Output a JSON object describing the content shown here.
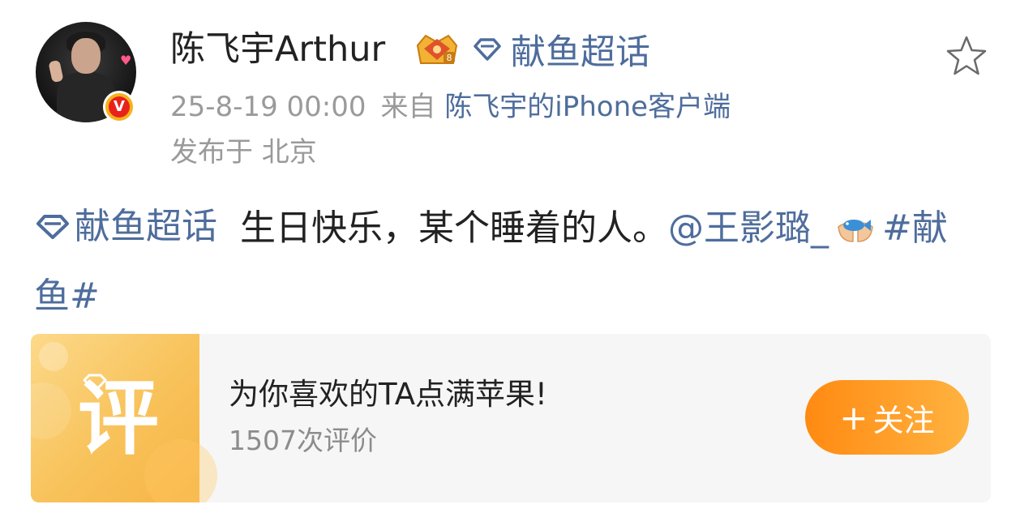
{
  "author": {
    "name": "陈飞宇Arthur",
    "verified_badge": "v-badge-icon",
    "member_badge": "crown-icon"
  },
  "topic": {
    "label": "献鱼超话",
    "icon": "diamond-icon"
  },
  "meta": {
    "date": "25-8-19 00:00",
    "source_prefix": "来自",
    "source": "陈飞宇的iPhone客户端",
    "location": "发布于 北京"
  },
  "post": {
    "topic_link": "献鱼超话",
    "text": "生日快乐，某个睡着的人。",
    "mention": "@王影璐_",
    "hashtag": "#献鱼#"
  },
  "card": {
    "thumb_char": "评",
    "title": "为你喜欢的TA点满苹果!",
    "subtitle": "1507次评价",
    "button_plus": "+",
    "button_label": "关注"
  },
  "colors": {
    "link": "#4e6d9c",
    "meta": "#9a9a9a",
    "button_start": "#ff8a12",
    "button_end": "#ffb340"
  }
}
